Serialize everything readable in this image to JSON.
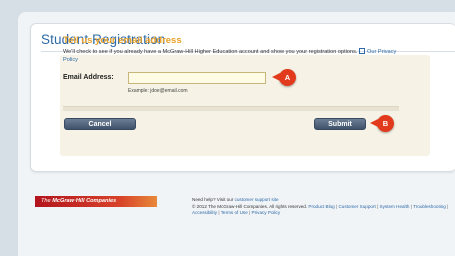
{
  "page": {
    "title": "Student Registration"
  },
  "form": {
    "heading": "Tell us your email address",
    "description": "We'll check to see if you already have a McGraw-Hill Higher Education account and show you your registration options.",
    "privacy_link": "Our Privacy Policy",
    "email_label": "Email Address:",
    "email_value": "",
    "email_placeholder": "",
    "example": "Example: jdoe@email.com"
  },
  "buttons": {
    "cancel": "Cancel",
    "submit": "Submit"
  },
  "callouts": {
    "a": "A",
    "b": "B"
  },
  "footer": {
    "logo_prefix": "The",
    "logo_brand": "McGraw·Hill Companies",
    "help_prefix": "Need help? Visit our",
    "help_link": "customer support site",
    "copyright": "© 2012 The McGraw-Hill Companies. All rights reserved.",
    "links": [
      "Product Blog",
      "Customer Support",
      "System Health",
      "Troubleshooting",
      "Accessibility",
      "Terms of Use",
      "Privacy Policy"
    ]
  },
  "colors": {
    "title_blue": "#2e6aa7",
    "heading_orange": "#e9a128",
    "callout_red": "#e13a1c",
    "button_slate": "#4a5e76"
  }
}
